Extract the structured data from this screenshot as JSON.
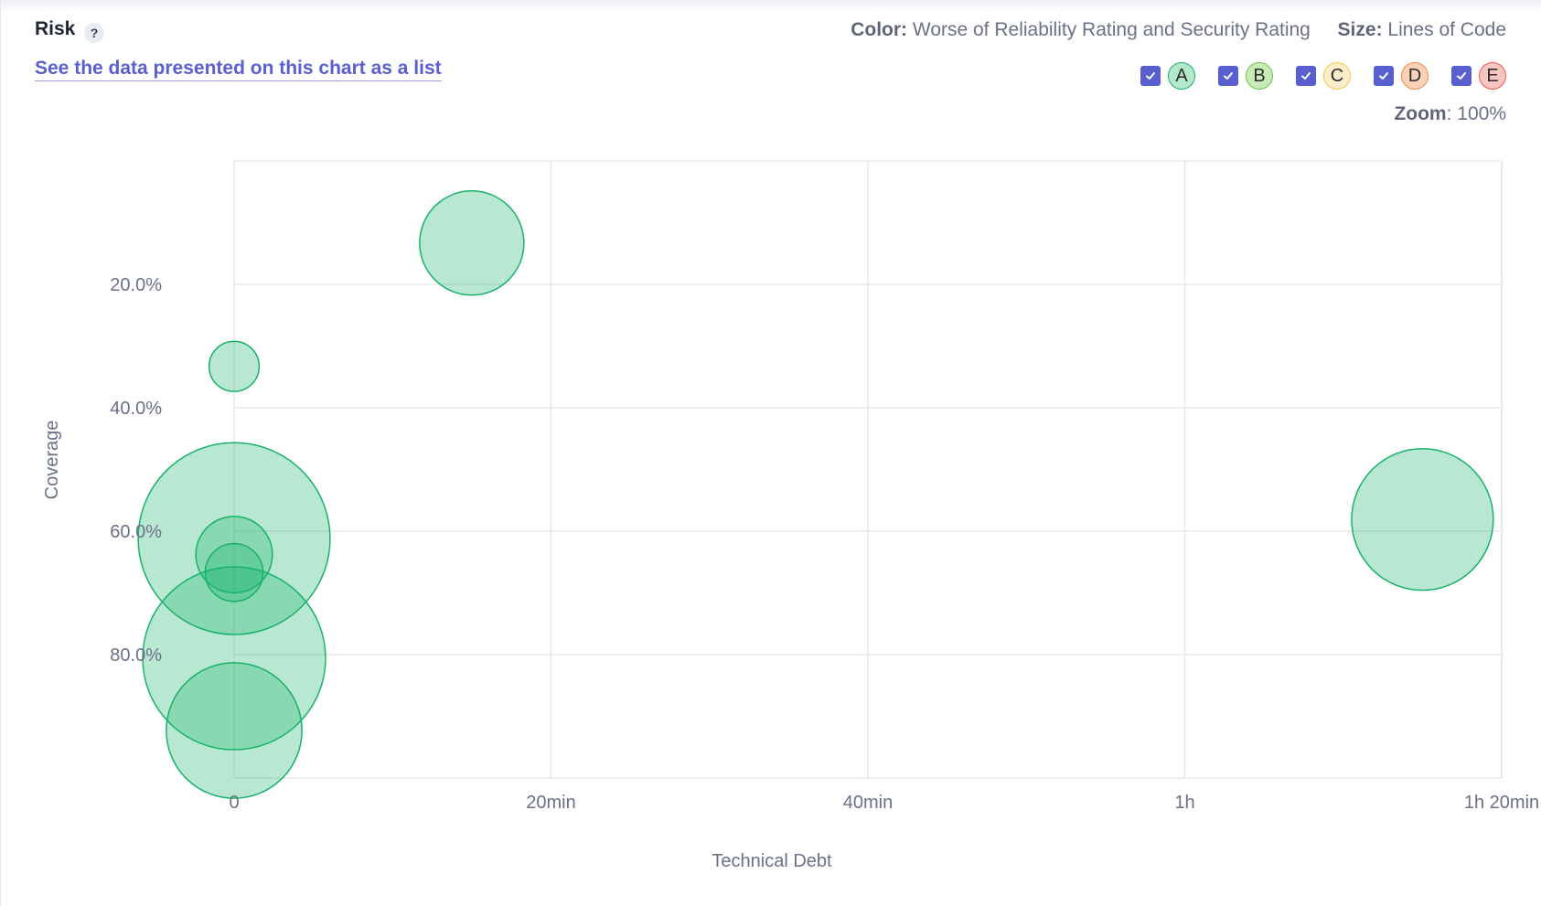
{
  "header": {
    "title": "Risk",
    "help_icon": "?",
    "list_link": "See the data presented on this chart as a list",
    "color_label": "Color:",
    "color_value": "Worse of Reliability Rating and Security Rating",
    "size_label": "Size:",
    "size_value": "Lines of Code",
    "zoom_label": "Zoom",
    "zoom_value": ": 100%"
  },
  "legend": [
    {
      "rating": "A",
      "checked": true,
      "fill": "#b4e8cb",
      "border": "#17b26a"
    },
    {
      "rating": "B",
      "checked": true,
      "fill": "#c9ebb5",
      "border": "#6cc24a"
    },
    {
      "rating": "C",
      "checked": true,
      "fill": "#fdeecb",
      "border": "#f3c94a"
    },
    {
      "rating": "D",
      "checked": true,
      "fill": "#fbd2b8",
      "border": "#f08a43"
    },
    {
      "rating": "E",
      "checked": true,
      "fill": "#f7c6c2",
      "border": "#e8574a"
    }
  ],
  "chart_data": {
    "type": "scatter",
    "xlabel": "Technical Debt",
    "ylabel": "Coverage",
    "x_unit": "minutes",
    "y_unit": "percent",
    "xlim": [
      0,
      80
    ],
    "ylim": [
      0,
      100
    ],
    "y_inverted": true,
    "grid": true,
    "x_ticks": [
      {
        "value": 0,
        "label": "0"
      },
      {
        "value": 20,
        "label": "20min"
      },
      {
        "value": 40,
        "label": "40min"
      },
      {
        "value": 60,
        "label": "1h"
      },
      {
        "value": 80,
        "label": "1h 20min"
      }
    ],
    "y_ticks": [
      {
        "value": 20,
        "label": "20.0%"
      },
      {
        "value": 40,
        "label": "40.0%"
      },
      {
        "value": 60,
        "label": "60.0%"
      },
      {
        "value": 80,
        "label": "80.0%"
      }
    ],
    "bubble_color": {
      "fill": "#17b26a",
      "fill_opacity": 0.3,
      "stroke": "#17b26a"
    },
    "points": [
      {
        "x": 15,
        "y": 13.3,
        "size": 1300,
        "rating": "A"
      },
      {
        "x": 0,
        "y": 33.3,
        "size": 300,
        "rating": "A"
      },
      {
        "x": 0,
        "y": 61.2,
        "size": 4400,
        "rating": "A"
      },
      {
        "x": 0,
        "y": 63.8,
        "size": 700,
        "rating": "A"
      },
      {
        "x": 0,
        "y": 66.7,
        "size": 400,
        "rating": "A"
      },
      {
        "x": 0,
        "y": 80.6,
        "size": 4000,
        "rating": "A"
      },
      {
        "x": 0,
        "y": 92.3,
        "size": 2200,
        "rating": "A"
      },
      {
        "x": 75,
        "y": 58.1,
        "size": 2400,
        "rating": "A"
      }
    ]
  }
}
